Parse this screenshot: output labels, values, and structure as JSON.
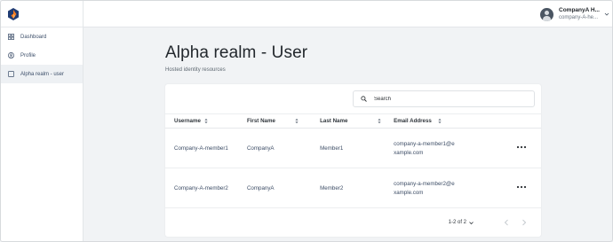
{
  "sidebar": {
    "items": [
      {
        "label": "Dashboard",
        "icon": "dashboard-grid-icon"
      },
      {
        "label": "Profile",
        "icon": "profile-circle-icon"
      },
      {
        "label": "Alpha realm - user",
        "icon": "square-icon",
        "active": true
      }
    ]
  },
  "header": {
    "user_name": "CompanyA H...",
    "user_realm": "company-A-he..."
  },
  "main": {
    "title": "Alpha realm - User",
    "subtitle": "Hosted identity resources",
    "search": {
      "placeholder": "Search"
    },
    "table": {
      "columns": [
        "Username",
        "First Name",
        "Last Name",
        "Email Address"
      ],
      "rows": [
        {
          "username": "Company-A-member1",
          "first_name": "CompanyA",
          "last_name": "Member1",
          "email": "company-a-member1@example.com"
        },
        {
          "username": "Company-A-member2",
          "first_name": "CompanyA",
          "last_name": "Member2",
          "email": "company-a-member2@example.com"
        }
      ]
    },
    "pagination": {
      "range": "1-2 of 2"
    }
  },
  "colors": {
    "background": "#f1f3f5",
    "link_text": "#3d4d66",
    "brand_orange": "#f47b20",
    "brand_navy": "#1f3b73"
  }
}
